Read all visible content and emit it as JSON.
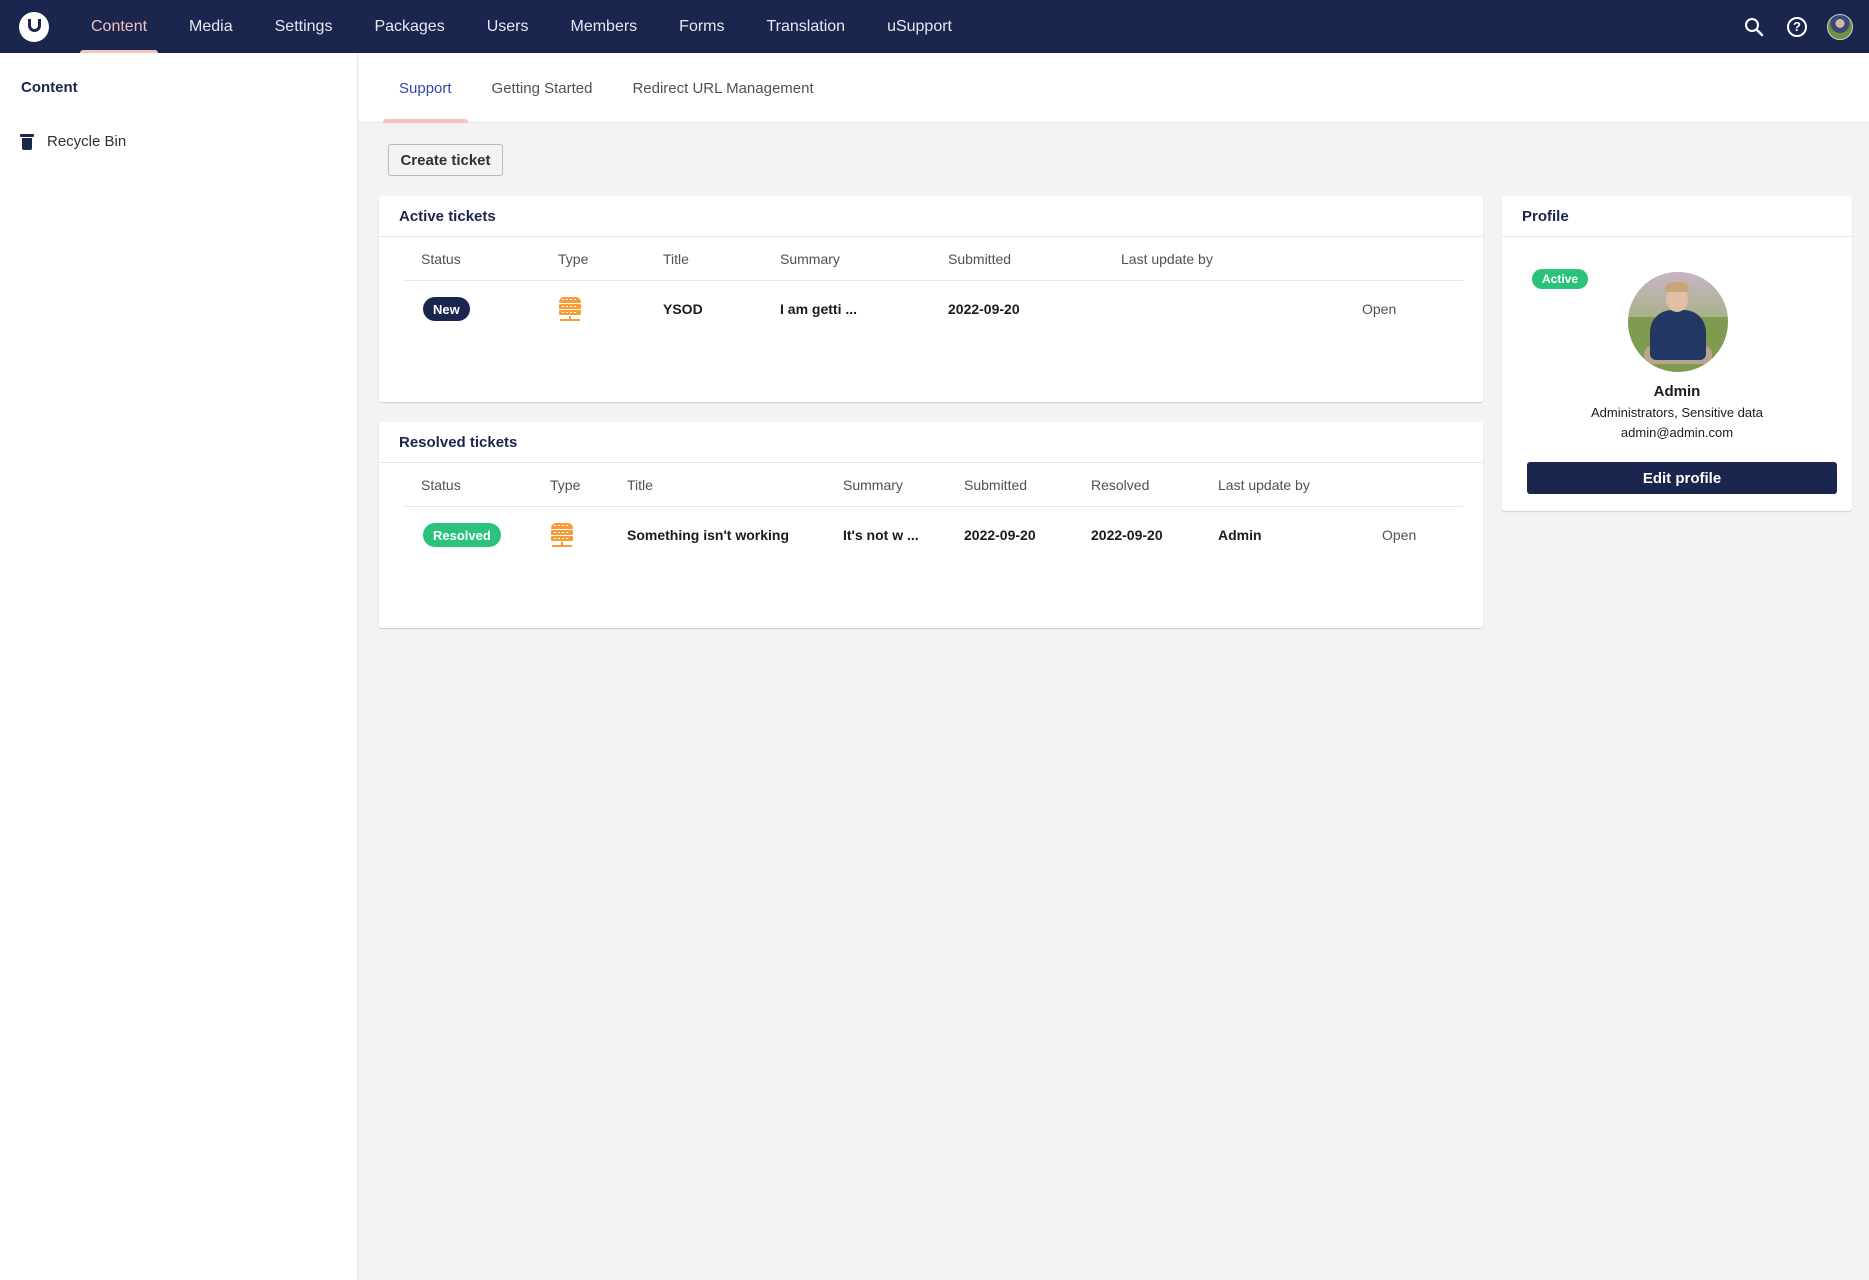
{
  "nav": {
    "items": [
      "Content",
      "Media",
      "Settings",
      "Packages",
      "Users",
      "Members",
      "Forms",
      "Translation",
      "uSupport"
    ],
    "active": "Content",
    "icons": [
      "search-icon",
      "help-icon",
      "user-avatar"
    ]
  },
  "sidebar": {
    "title": "Content",
    "items": [
      {
        "label": "Recycle Bin",
        "icon": "trash-icon"
      }
    ]
  },
  "tabs": {
    "items": [
      "Support",
      "Getting Started",
      "Redirect URL Management"
    ],
    "active": "Support"
  },
  "actions": {
    "create_ticket": "Create ticket"
  },
  "active_tickets": {
    "title": "Active tickets",
    "columns": [
      "Status",
      "Type",
      "Title",
      "Summary",
      "Submitted",
      "Last update by"
    ],
    "rows": [
      {
        "status": "New",
        "type_icon": "server-icon",
        "title": "YSOD",
        "summary": "I am getti ...",
        "submitted": "2022-09-20",
        "last_update_by": "",
        "action": "Open"
      }
    ]
  },
  "resolved_tickets": {
    "title": "Resolved tickets",
    "columns": [
      "Status",
      "Type",
      "Title",
      "Summary",
      "Submitted",
      "Resolved",
      "Last update by"
    ],
    "rows": [
      {
        "status": "Resolved",
        "type_icon": "server-icon",
        "title": "Something isn't working",
        "summary": "It's not w ...",
        "submitted": "2022-09-20",
        "resolved": "2022-09-20",
        "last_update_by": "Admin",
        "action": "Open"
      }
    ]
  },
  "profile": {
    "title": "Profile",
    "status": "Active",
    "name": "Admin",
    "groups": "Administrators, Sensitive data",
    "email": "admin@admin.com",
    "edit_button": "Edit profile"
  },
  "colors": {
    "header_bg": "#1b264f",
    "accent_pink": "#f5c1bc",
    "new_badge": "#1b264f",
    "resolved_badge": "#2bc37c",
    "type_icon": "#f79c37"
  }
}
